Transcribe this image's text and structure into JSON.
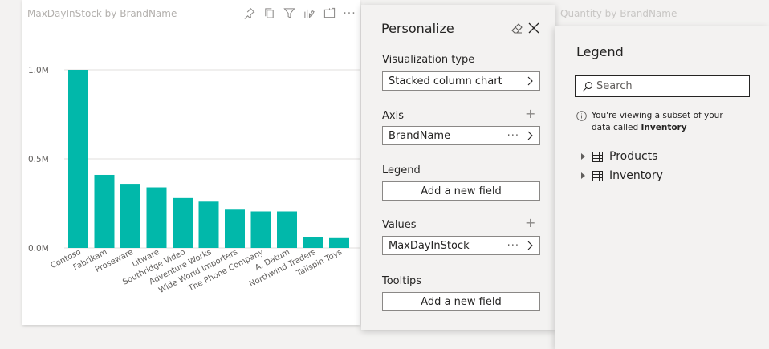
{
  "chart_card": {
    "title": "MaxDayInStock by BrandName",
    "toolbar": [
      "pin-icon",
      "copy-icon",
      "filter-icon",
      "personalize-icon",
      "focus-mode-icon",
      "more-options-icon"
    ],
    "more_label": "···"
  },
  "chart_data": {
    "type": "bar",
    "title": "MaxDayInStock by BrandName",
    "categories": [
      "Contoso",
      "Fabrikam",
      "Proseware",
      "Litware",
      "Southridge Video",
      "Adventure Works",
      "Wide World Importers",
      "The Phone Company",
      "A. Datum",
      "Northwind Traders",
      "Tailspin Toys"
    ],
    "values": [
      1000000,
      410000,
      360000,
      340000,
      280000,
      260000,
      215000,
      205000,
      205000,
      60000,
      55000
    ],
    "y_ticks": [
      {
        "value": 0,
        "label": "0.0M"
      },
      {
        "value": 500000,
        "label": "0.5M"
      },
      {
        "value": 1000000,
        "label": "1.0M"
      }
    ],
    "ylim": [
      0,
      1000000
    ],
    "color": "#01b8aa",
    "grid": true
  },
  "background_card": {
    "title": "Quantity by BrandName"
  },
  "personalize": {
    "title": "Personalize",
    "sections": {
      "visualization_type": {
        "label": "Visualization type",
        "value": "Stacked column chart"
      },
      "axis": {
        "label": "Axis",
        "value": "BrandName",
        "dots": "···",
        "plus": "+"
      },
      "legend": {
        "label": "Legend",
        "add": "Add a new field"
      },
      "values": {
        "label": "Values",
        "value": "MaxDayInStock",
        "dots": "···",
        "plus": "+"
      },
      "tooltips": {
        "label": "Tooltips",
        "add": "Add a new field"
      }
    }
  },
  "legend_flyout": {
    "title": "Legend",
    "search_placeholder": "Search",
    "info_prefix": "You're viewing a subset of your data called ",
    "info_bold": "Inventory",
    "tables": [
      "Products",
      "Inventory"
    ]
  }
}
